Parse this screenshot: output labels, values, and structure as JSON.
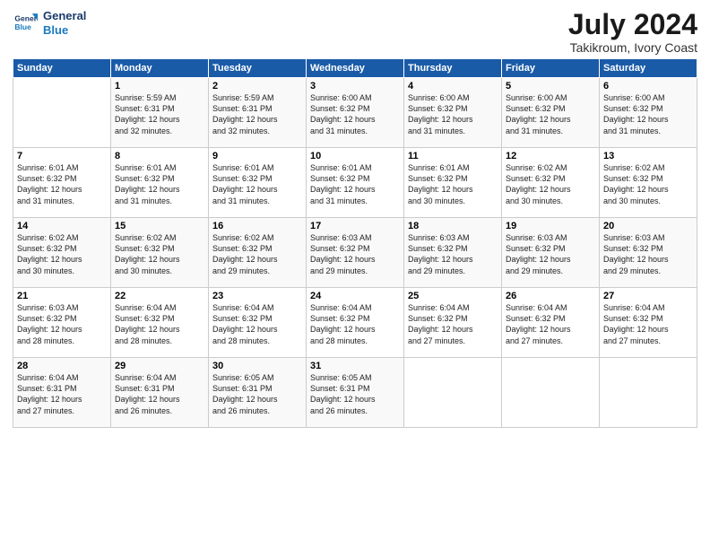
{
  "header": {
    "logo_line1": "General",
    "logo_line2": "Blue",
    "month_year": "July 2024",
    "location": "Takikroum, Ivory Coast"
  },
  "weekdays": [
    "Sunday",
    "Monday",
    "Tuesday",
    "Wednesday",
    "Thursday",
    "Friday",
    "Saturday"
  ],
  "weeks": [
    [
      {
        "day": "",
        "info": ""
      },
      {
        "day": "1",
        "info": "Sunrise: 5:59 AM\nSunset: 6:31 PM\nDaylight: 12 hours\nand 32 minutes."
      },
      {
        "day": "2",
        "info": "Sunrise: 5:59 AM\nSunset: 6:31 PM\nDaylight: 12 hours\nand 32 minutes."
      },
      {
        "day": "3",
        "info": "Sunrise: 6:00 AM\nSunset: 6:32 PM\nDaylight: 12 hours\nand 31 minutes."
      },
      {
        "day": "4",
        "info": "Sunrise: 6:00 AM\nSunset: 6:32 PM\nDaylight: 12 hours\nand 31 minutes."
      },
      {
        "day": "5",
        "info": "Sunrise: 6:00 AM\nSunset: 6:32 PM\nDaylight: 12 hours\nand 31 minutes."
      },
      {
        "day": "6",
        "info": "Sunrise: 6:00 AM\nSunset: 6:32 PM\nDaylight: 12 hours\nand 31 minutes."
      }
    ],
    [
      {
        "day": "7",
        "info": "Sunrise: 6:01 AM\nSunset: 6:32 PM\nDaylight: 12 hours\nand 31 minutes."
      },
      {
        "day": "8",
        "info": "Sunrise: 6:01 AM\nSunset: 6:32 PM\nDaylight: 12 hours\nand 31 minutes."
      },
      {
        "day": "9",
        "info": "Sunrise: 6:01 AM\nSunset: 6:32 PM\nDaylight: 12 hours\nand 31 minutes."
      },
      {
        "day": "10",
        "info": "Sunrise: 6:01 AM\nSunset: 6:32 PM\nDaylight: 12 hours\nand 31 minutes."
      },
      {
        "day": "11",
        "info": "Sunrise: 6:01 AM\nSunset: 6:32 PM\nDaylight: 12 hours\nand 30 minutes."
      },
      {
        "day": "12",
        "info": "Sunrise: 6:02 AM\nSunset: 6:32 PM\nDaylight: 12 hours\nand 30 minutes."
      },
      {
        "day": "13",
        "info": "Sunrise: 6:02 AM\nSunset: 6:32 PM\nDaylight: 12 hours\nand 30 minutes."
      }
    ],
    [
      {
        "day": "14",
        "info": "Sunrise: 6:02 AM\nSunset: 6:32 PM\nDaylight: 12 hours\nand 30 minutes."
      },
      {
        "day": "15",
        "info": "Sunrise: 6:02 AM\nSunset: 6:32 PM\nDaylight: 12 hours\nand 30 minutes."
      },
      {
        "day": "16",
        "info": "Sunrise: 6:02 AM\nSunset: 6:32 PM\nDaylight: 12 hours\nand 29 minutes."
      },
      {
        "day": "17",
        "info": "Sunrise: 6:03 AM\nSunset: 6:32 PM\nDaylight: 12 hours\nand 29 minutes."
      },
      {
        "day": "18",
        "info": "Sunrise: 6:03 AM\nSunset: 6:32 PM\nDaylight: 12 hours\nand 29 minutes."
      },
      {
        "day": "19",
        "info": "Sunrise: 6:03 AM\nSunset: 6:32 PM\nDaylight: 12 hours\nand 29 minutes."
      },
      {
        "day": "20",
        "info": "Sunrise: 6:03 AM\nSunset: 6:32 PM\nDaylight: 12 hours\nand 29 minutes."
      }
    ],
    [
      {
        "day": "21",
        "info": "Sunrise: 6:03 AM\nSunset: 6:32 PM\nDaylight: 12 hours\nand 28 minutes."
      },
      {
        "day": "22",
        "info": "Sunrise: 6:04 AM\nSunset: 6:32 PM\nDaylight: 12 hours\nand 28 minutes."
      },
      {
        "day": "23",
        "info": "Sunrise: 6:04 AM\nSunset: 6:32 PM\nDaylight: 12 hours\nand 28 minutes."
      },
      {
        "day": "24",
        "info": "Sunrise: 6:04 AM\nSunset: 6:32 PM\nDaylight: 12 hours\nand 28 minutes."
      },
      {
        "day": "25",
        "info": "Sunrise: 6:04 AM\nSunset: 6:32 PM\nDaylight: 12 hours\nand 27 minutes."
      },
      {
        "day": "26",
        "info": "Sunrise: 6:04 AM\nSunset: 6:32 PM\nDaylight: 12 hours\nand 27 minutes."
      },
      {
        "day": "27",
        "info": "Sunrise: 6:04 AM\nSunset: 6:32 PM\nDaylight: 12 hours\nand 27 minutes."
      }
    ],
    [
      {
        "day": "28",
        "info": "Sunrise: 6:04 AM\nSunset: 6:31 PM\nDaylight: 12 hours\nand 27 minutes."
      },
      {
        "day": "29",
        "info": "Sunrise: 6:04 AM\nSunset: 6:31 PM\nDaylight: 12 hours\nand 26 minutes."
      },
      {
        "day": "30",
        "info": "Sunrise: 6:05 AM\nSunset: 6:31 PM\nDaylight: 12 hours\nand 26 minutes."
      },
      {
        "day": "31",
        "info": "Sunrise: 6:05 AM\nSunset: 6:31 PM\nDaylight: 12 hours\nand 26 minutes."
      },
      {
        "day": "",
        "info": ""
      },
      {
        "day": "",
        "info": ""
      },
      {
        "day": "",
        "info": ""
      }
    ]
  ]
}
